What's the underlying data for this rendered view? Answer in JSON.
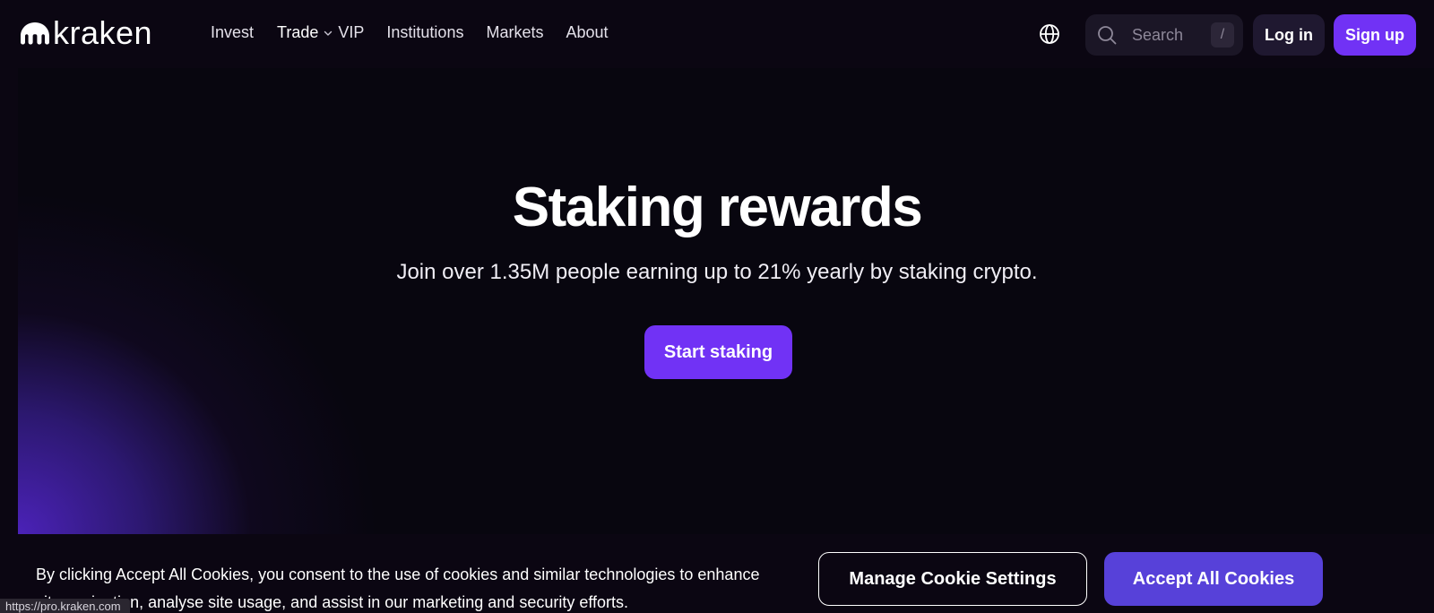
{
  "header": {
    "logo_text": "kraken",
    "nav": {
      "invest": "Invest",
      "trade": "Trade",
      "vip": "VIP",
      "institutions": "Institutions",
      "markets": "Markets",
      "about": "About"
    },
    "search": {
      "placeholder": "Search",
      "shortcut": "/"
    },
    "login_label": "Log in",
    "signup_label": "Sign up"
  },
  "hero": {
    "title": "Staking rewards",
    "subtitle": "Join over 1.35M people earning up to 21% yearly by staking crypto.",
    "cta_label": "Start staking"
  },
  "cookie_banner": {
    "text": "By clicking Accept All Cookies, you consent to the use of cookies and similar technologies to enhance site navigation, analyse site usage, and assist in our marketing and security efforts.",
    "manage_label": "Manage Cookie Settings",
    "accept_label": "Accept All Cookies"
  },
  "status_bar": {
    "url": "https://pro.kraken.com"
  },
  "colors": {
    "background": "#0b0612",
    "brand_purple": "#7132f5",
    "accept_purple": "#5741d9",
    "login_bg": "#1f1830"
  },
  "icons": {
    "logo": "kraken-logo-icon",
    "trade_chevron": "chevron-down-icon",
    "language": "globe-icon",
    "search": "search-icon"
  }
}
